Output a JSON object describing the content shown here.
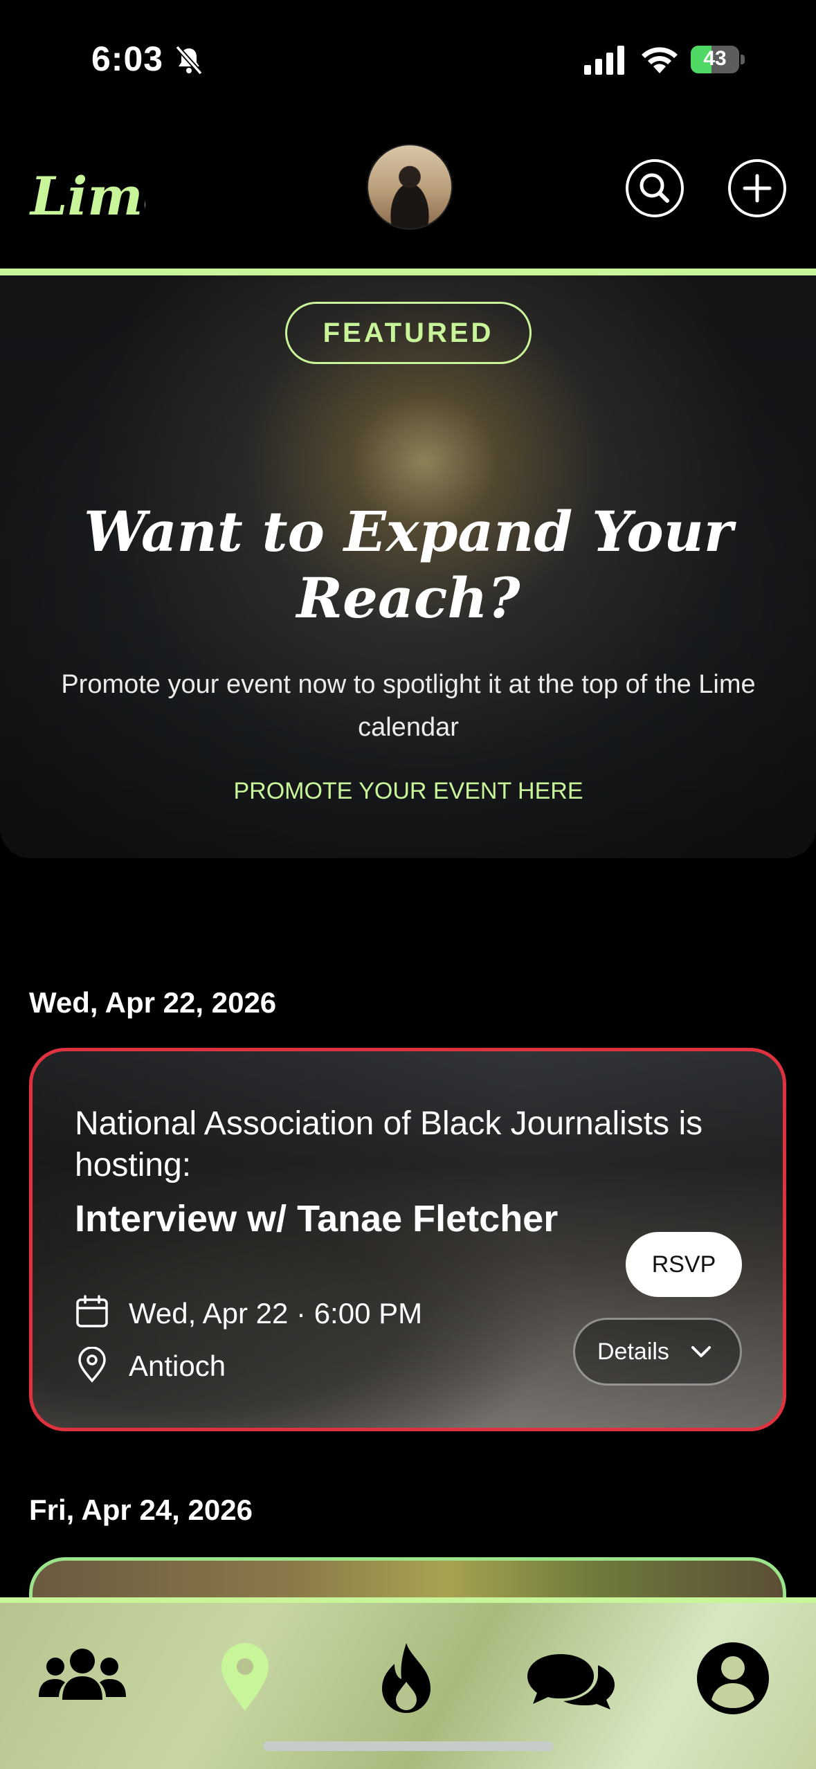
{
  "status_bar": {
    "time": "6:03",
    "battery": "43",
    "battery_level": 0.43
  },
  "header": {
    "logo_text": "Lime"
  },
  "featured": {
    "badge": "FEATURED",
    "title": "Want to Expand Your Reach?",
    "description": "Promote your event now to spotlight it at the top of the Lime calendar",
    "link_label": "PROMOTE YOUR EVENT HERE"
  },
  "sections": [
    {
      "date": "Wed, Apr 22, 2026",
      "event": {
        "host_line": "National Association of Black Journalists is hosting:",
        "title": "Interview w/ Tanae Fletcher",
        "datetime": "Wed, Apr 22 · 6:00 PM",
        "location": "Antioch",
        "rsvp_label": "RSVP",
        "details_label": "Details",
        "border_color": "#e0313f"
      }
    },
    {
      "date": "Fri, Apr 24, 2026",
      "event": {
        "border_color": "#9be48a"
      }
    }
  ],
  "colors": {
    "accent": "#c9f59a",
    "background": "#000000"
  },
  "tab_bar": {
    "items": [
      {
        "icon": "community-icon",
        "active": false
      },
      {
        "icon": "map-pin-icon",
        "active": true
      },
      {
        "icon": "flame-icon",
        "active": false
      },
      {
        "icon": "messages-icon",
        "active": false
      },
      {
        "icon": "profile-icon",
        "active": false
      }
    ]
  }
}
